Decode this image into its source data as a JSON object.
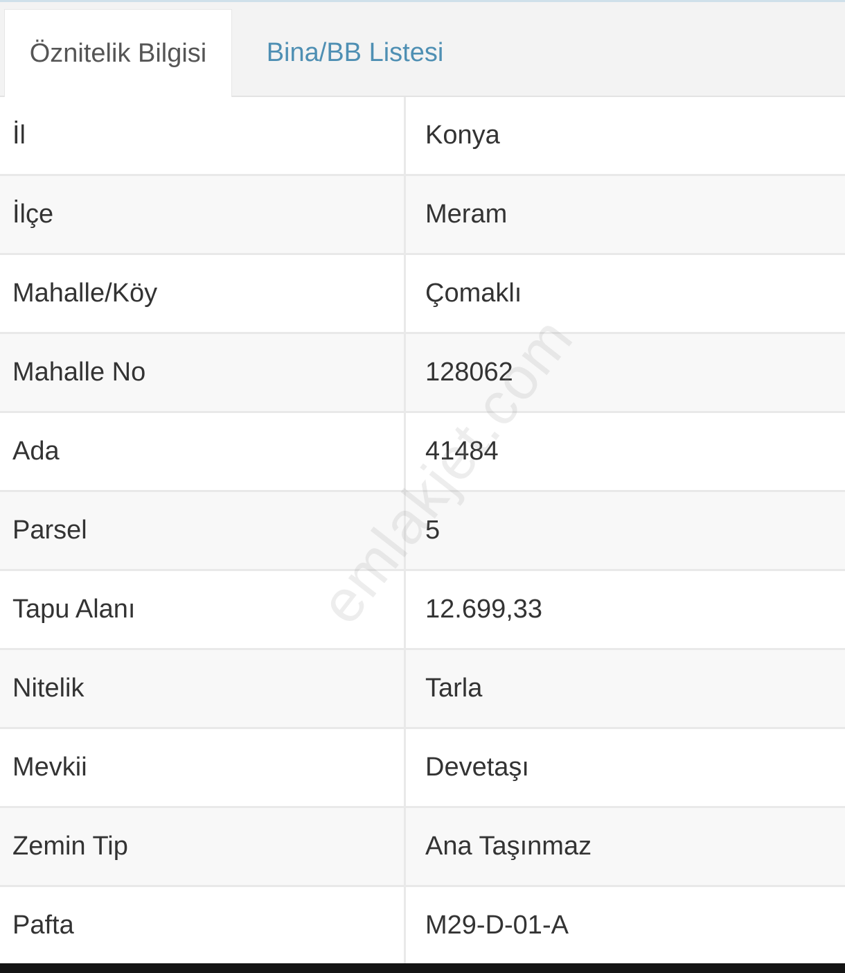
{
  "tabs": [
    {
      "label": "Öznitelik Bilgisi",
      "active": true
    },
    {
      "label": "Bina/BB Listesi",
      "active": false
    }
  ],
  "rows": [
    {
      "key": "İl",
      "value": "Konya"
    },
    {
      "key": "İlçe",
      "value": "Meram"
    },
    {
      "key": "Mahalle/Köy",
      "value": "Çomaklı"
    },
    {
      "key": "Mahalle No",
      "value": "128062"
    },
    {
      "key": "Ada",
      "value": "41484"
    },
    {
      "key": "Parsel",
      "value": "5"
    },
    {
      "key": "Tapu Alanı",
      "value": "12.699,33"
    },
    {
      "key": "Nitelik",
      "value": "Tarla"
    },
    {
      "key": "Mevkii",
      "value": "Devetaşı"
    },
    {
      "key": "Zemin Tip",
      "value": "Ana Taşınmaz"
    },
    {
      "key": "Pafta",
      "value": "M29-D-01-A"
    }
  ],
  "watermark": "emlakjet.com",
  "colors": {
    "tab_active_text": "#555555",
    "tab_inactive_text": "#4e8fb3",
    "cell_text": "#333333",
    "border": "#e9e9e9"
  }
}
